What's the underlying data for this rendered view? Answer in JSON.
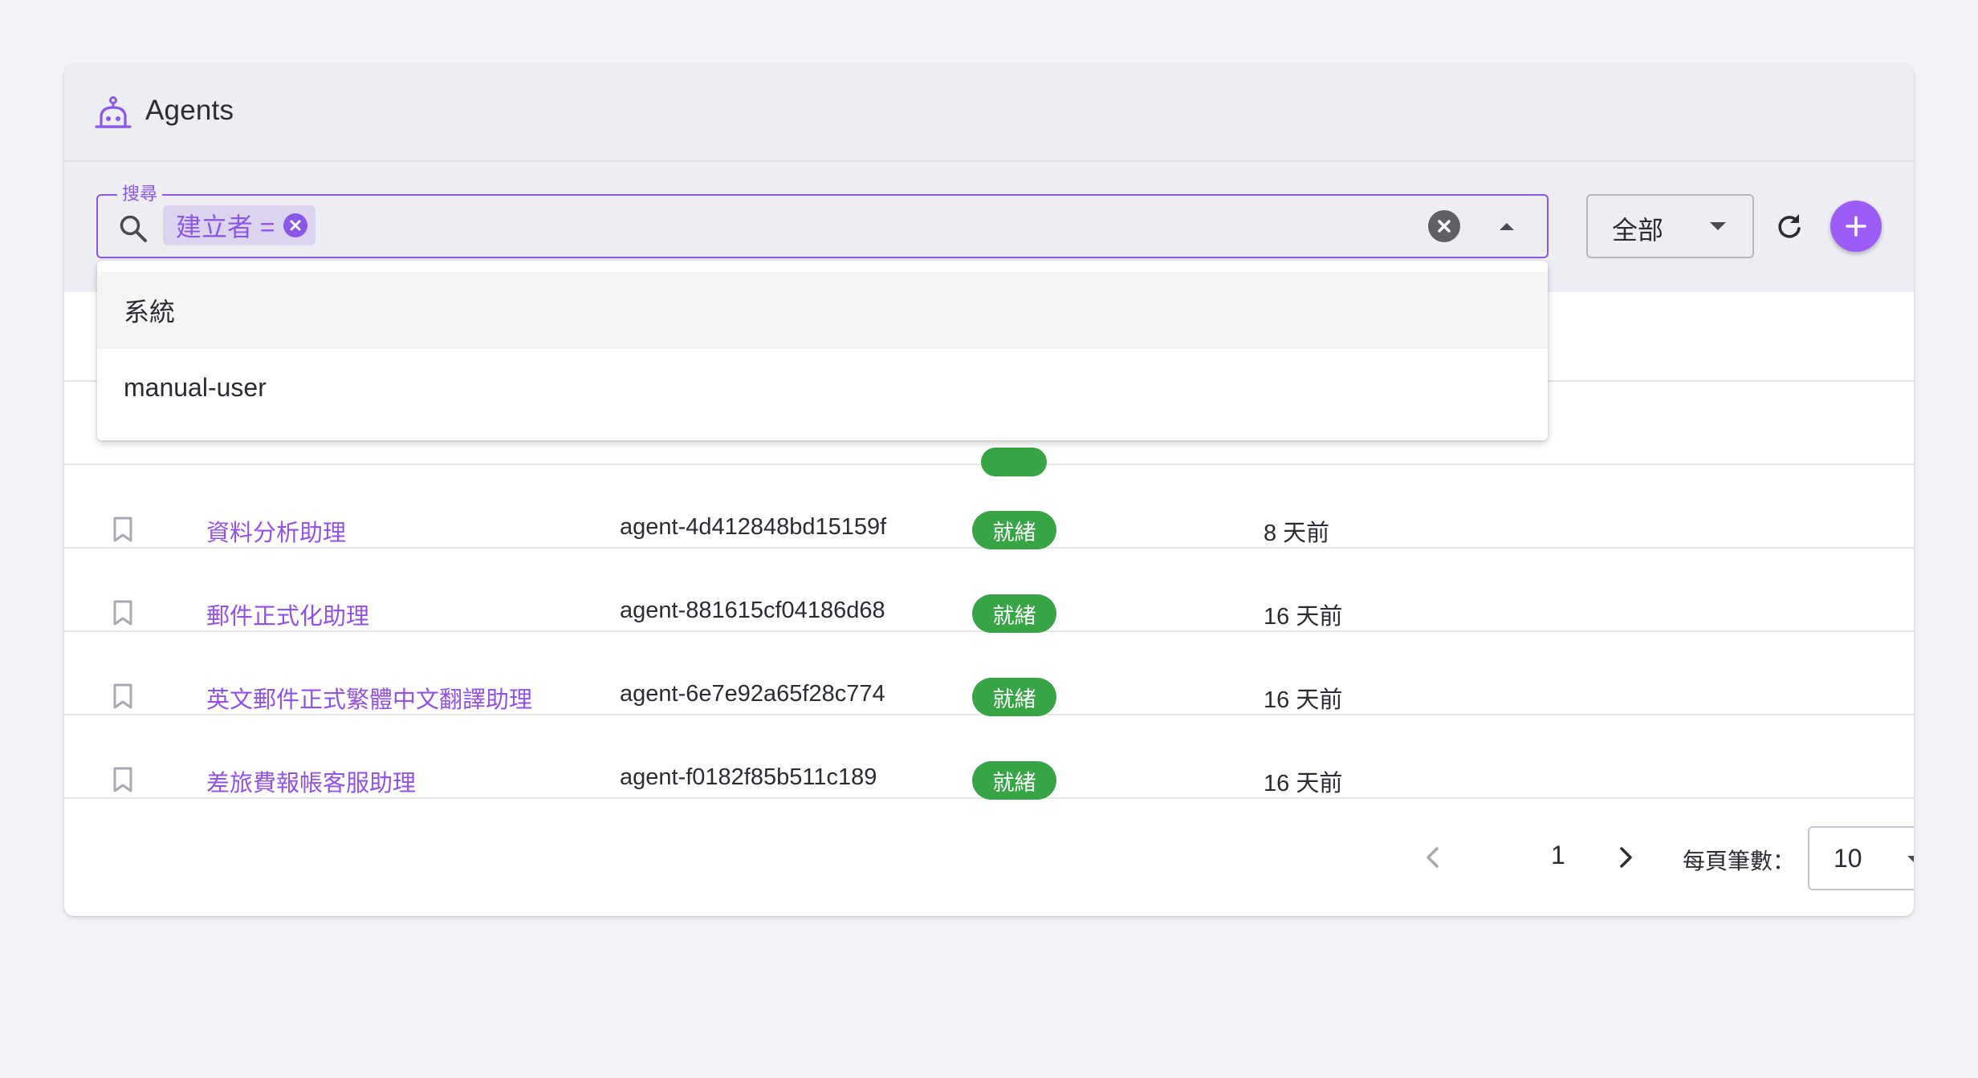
{
  "header": {
    "title": "Agents",
    "icon": "robot-icon"
  },
  "search": {
    "legend": "搜尋",
    "chip_label": "建立者 =",
    "icons": [
      "search-icon",
      "clear-icon",
      "caret-up-icon",
      "chip-close-icon"
    ]
  },
  "filter": {
    "value": "全部"
  },
  "dropdown": {
    "options": [
      "系統",
      "manual-user"
    ]
  },
  "table": {
    "rows": [
      {
        "name": "資料分析助理",
        "id": "agent-4d412848bd15159f",
        "status": "就緒",
        "updated": "8 天前"
      },
      {
        "name": "郵件正式化助理",
        "id": "agent-881615cf04186d68",
        "status": "就緒",
        "updated": "16 天前"
      },
      {
        "name": "英文郵件正式繁體中文翻譯助理",
        "id": "agent-6e7e92a65f28c774",
        "status": "就緒",
        "updated": "16 天前"
      },
      {
        "name": "差旅費報帳客服助理",
        "id": "agent-f0182f85b511c189",
        "status": "就緒",
        "updated": "16 天前"
      }
    ]
  },
  "pagination": {
    "page": "1",
    "page_size_label": "每頁筆數：",
    "page_size": "10"
  },
  "colors": {
    "accent": "#9c5cf5",
    "link": "#9252e8",
    "status_ready": "#37a446",
    "background": "#f2f3f8"
  }
}
